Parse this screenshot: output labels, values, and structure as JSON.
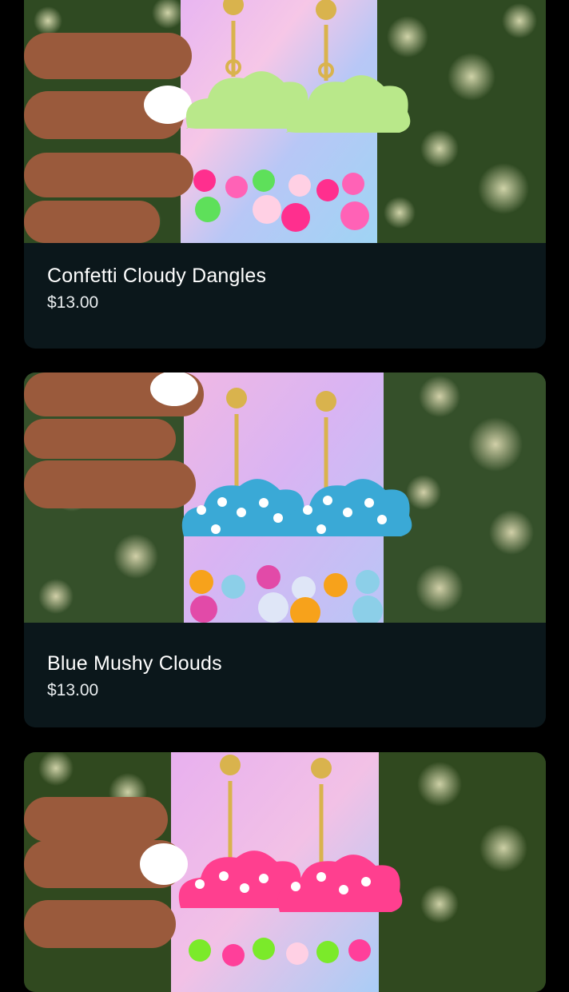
{
  "products": [
    {
      "title": "Confetti Cloudy Dangles",
      "price": "$13.00",
      "cloud_color": "#b9e88a",
      "cloud_accent": "#7fd6b0",
      "bead_colors": [
        "#ff2f8e",
        "#ff62b6",
        "#5ee05a",
        "#ffd0e4"
      ],
      "image_icon": "earrings-photo"
    },
    {
      "title": "Blue Mushy Clouds",
      "price": "$13.00",
      "cloud_color": "#3aa9d6",
      "cloud_accent": "#ffffff",
      "bead_colors": [
        "#f7a21b",
        "#8ccfe8",
        "#e24aa8",
        "#dfe6f7"
      ],
      "image_icon": "earrings-photo"
    },
    {
      "title": "",
      "price": "",
      "cloud_color": "#ff3f8f",
      "cloud_accent": "#ffffff",
      "bead_colors": [
        "#7bea2a",
        "#ff3f9a",
        "#7bea2a",
        "#ffd0e4"
      ],
      "image_icon": "earrings-photo"
    }
  ],
  "colors": {
    "page_background": "#000000",
    "card_background": "#0b171b",
    "title_text": "#ffffff",
    "price_text": "#e8ecee",
    "foliage": "#2f4a22",
    "card_holo": "#d7a8ee"
  }
}
